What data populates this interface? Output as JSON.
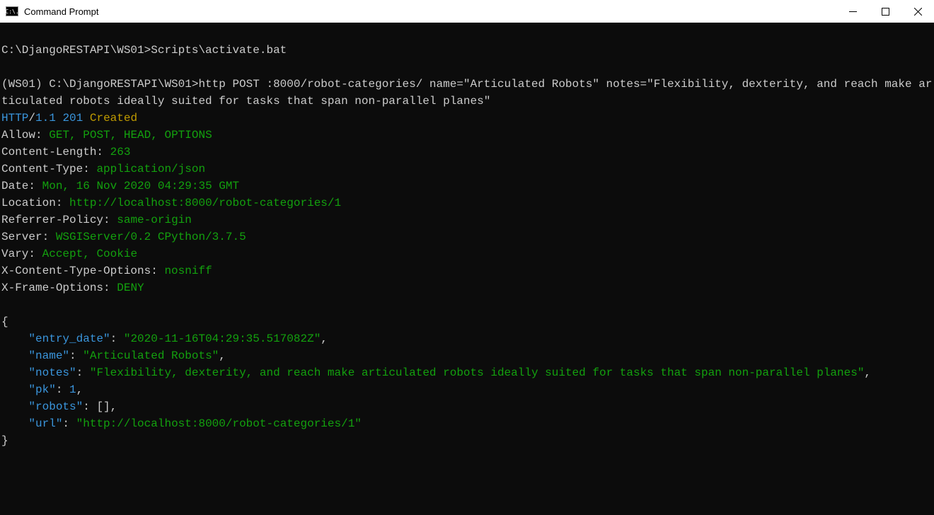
{
  "window": {
    "title": "Command Prompt",
    "icon_text": "C:\\."
  },
  "terminal": {
    "prompt1": "C:\\DjangoRESTAPI\\WS01>",
    "cmd1": "Scripts\\activate.bat",
    "prompt2": "(WS01) C:\\DjangoRESTAPI\\WS01>",
    "cmd2": "http POST :8000/robot-categories/ name=\"Articulated Robots\" notes=\"Flexibility, dexterity, and reach make articulated robots ideally suited for tasks that span non-parallel planes\"",
    "status": {
      "http": "HTTP",
      "slash": "/",
      "ver": "1.1",
      "code": "201",
      "msg": "Created"
    },
    "headers": [
      {
        "k": "Allow",
        "v": "GET, POST, HEAD, OPTIONS"
      },
      {
        "k": "Content-Length",
        "v": "263"
      },
      {
        "k": "Content-Type",
        "v": "application/json"
      },
      {
        "k": "Date",
        "v": "Mon, 16 Nov 2020 04:29:35 GMT"
      },
      {
        "k": "Location",
        "v": "http://localhost:8000/robot-categories/1"
      },
      {
        "k": "Referrer-Policy",
        "v": "same-origin"
      },
      {
        "k": "Server",
        "v": "WSGIServer/0.2 CPython/3.7.5"
      },
      {
        "k": "Vary",
        "v": "Accept, Cookie"
      },
      {
        "k": "X-Content-Type-Options",
        "v": "nosniff"
      },
      {
        "k": "X-Frame-Options",
        "v": "DENY"
      }
    ],
    "json": {
      "brace_open": "{",
      "brace_close": "}",
      "indent": "    ",
      "entries": [
        {
          "key": "\"entry_date\"",
          "val": "\"2020-11-16T04:29:35.517082Z\"",
          "cls": "g",
          "comma": ","
        },
        {
          "key": "\"name\"",
          "val": "\"Articulated Robots\"",
          "cls": "g",
          "comma": ","
        },
        {
          "key": "\"notes\"",
          "val": "\"Flexibility, dexterity, and reach make articulated robots ideally suited for tasks that span non-parallel planes\"",
          "cls": "g",
          "comma": ","
        },
        {
          "key": "\"pk\"",
          "val": "1",
          "cls": "c",
          "comma": ","
        },
        {
          "key": "\"robots\"",
          "val": "[]",
          "cls": "w",
          "comma": ","
        },
        {
          "key": "\"url\"",
          "val": "\"http://localhost:8000/robot-categories/1\"",
          "cls": "g",
          "comma": ""
        }
      ]
    }
  }
}
